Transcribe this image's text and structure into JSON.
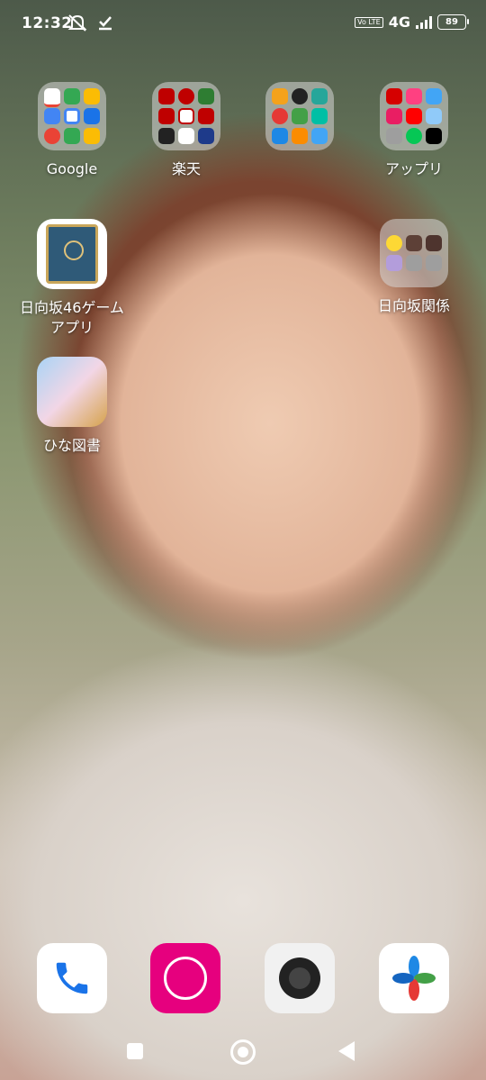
{
  "status_bar": {
    "time": "12:32",
    "network": "4G",
    "volte": "Vo LTE",
    "battery": "89"
  },
  "home_screen": {
    "google_folder": {
      "label": "Google"
    },
    "rakuten_folder": {
      "label": "楽天"
    },
    "tools_folder": {
      "label": ""
    },
    "apps_folder": {
      "label": "アップリ"
    },
    "game_app": {
      "label": "日向坂46ゲームアプリ"
    },
    "hinatazaka_folder": {
      "label": "日向坂関係"
    },
    "hina_books_app": {
      "label": "ひな図書"
    }
  },
  "dock": {
    "apps": [
      "phone-icon",
      "rakuten-link-icon",
      "camera-icon",
      "photos-icon"
    ]
  },
  "colors": {
    "rakuten_pink": "#e6007e",
    "folder_bg": "#d7d7d7"
  }
}
